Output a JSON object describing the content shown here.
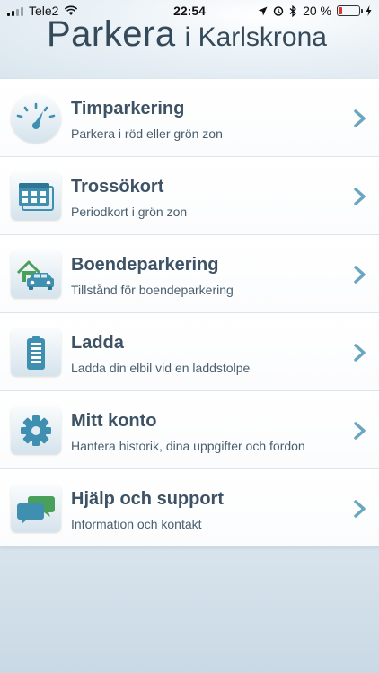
{
  "status": {
    "carrier": "Tele2",
    "time": "22:54",
    "battery_percent": "20 %",
    "battery_level": 0.2
  },
  "header": {
    "title_main": "Parkera",
    "title_sub": "i Karlskrona"
  },
  "menu": [
    {
      "title": "Timparkering",
      "subtitle": "Parkera i röd eller grön zon",
      "icon": "parking-meter-gauge-icon"
    },
    {
      "title": "Trossökort",
      "subtitle": "Periodkort i grön zon",
      "icon": "calendar-cards-icon"
    },
    {
      "title": "Boendeparkering",
      "subtitle": "Tillstånd för boendeparkering",
      "icon": "house-car-icon"
    },
    {
      "title": "Ladda",
      "subtitle": "Ladda din elbil vid en laddstolpe",
      "icon": "battery-icon"
    },
    {
      "title": "Mitt konto",
      "subtitle": "Hantera historik, dina uppgifter och fordon",
      "icon": "gear-icon"
    },
    {
      "title": "Hjälp och support",
      "subtitle": "Information och kontakt",
      "icon": "chat-bubbles-icon"
    }
  ],
  "colors": {
    "accent": "#3f8fb0",
    "title_text": "#3d5264",
    "chevron": "#6aa6bf"
  }
}
